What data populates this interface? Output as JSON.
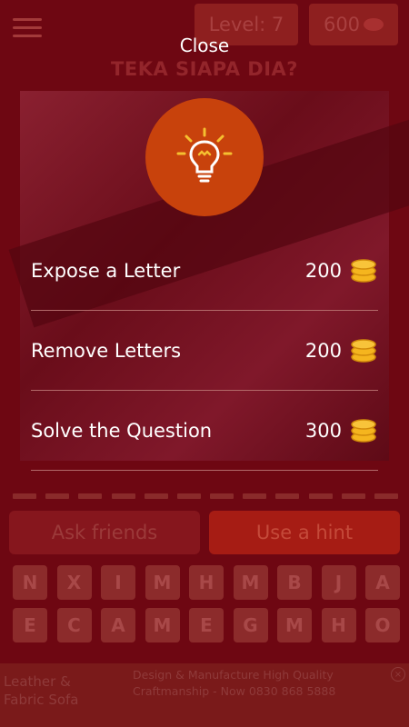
{
  "background": {
    "level": "Level: 7",
    "coins": "600",
    "question": "TEKA SIAPA DIA?",
    "answer_slots": 12,
    "ask_friends_label": "Ask friends",
    "use_hint_label": "Use a hint",
    "keyboard_row1": [
      "N",
      "X",
      "I",
      "M",
      "H",
      "M",
      "B",
      "J",
      "A"
    ],
    "keyboard_row2": [
      "E",
      "C",
      "A",
      "M",
      "E",
      "G",
      "M",
      "H",
      "O"
    ],
    "ad": {
      "left_line1": "Leather &",
      "left_line2": "Fabric Sofa",
      "right_line1": "Design & Manufacture High Quality",
      "right_line2": "Craftmanship - Now 0830 868 5888"
    }
  },
  "modal": {
    "close_label": "Close",
    "icon": "lightbulb-icon",
    "options": [
      {
        "label": "Expose a Letter",
        "cost": "200"
      },
      {
        "label": "Remove Letters",
        "cost": "200"
      },
      {
        "label": "Solve the Question",
        "cost": "300"
      }
    ]
  },
  "colors": {
    "overlay_bg": "#6e0712",
    "bulb_circle": "#c8420c",
    "coin": "#f5b51e",
    "bulb": "#f5c030"
  }
}
